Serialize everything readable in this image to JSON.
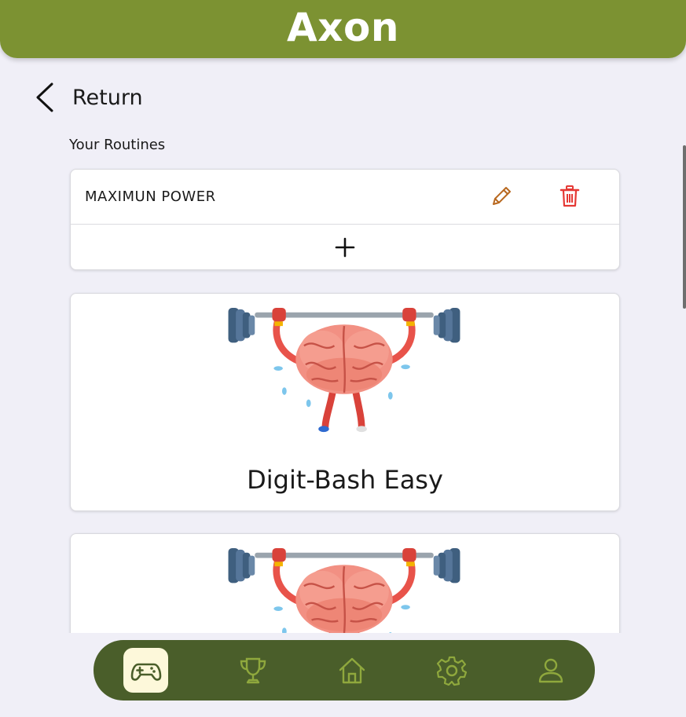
{
  "app": {
    "title": "Axon"
  },
  "nav_back": {
    "label": "Return"
  },
  "routines": {
    "heading": "Your Routines",
    "items": [
      {
        "name": "MAXIMUN POWER"
      }
    ],
    "add_icon": "plus-icon",
    "edit_icon": "pencil-icon",
    "delete_icon": "trash-icon"
  },
  "games": [
    {
      "title": "Digit-Bash Easy",
      "image": "brain-lifting-barbell"
    },
    {
      "title": "",
      "image": "brain-lifting-barbell"
    }
  ],
  "bottom_nav": {
    "items": [
      {
        "icon": "gamepad-icon",
        "active": true
      },
      {
        "icon": "trophy-icon",
        "active": false
      },
      {
        "icon": "home-icon",
        "active": false
      },
      {
        "icon": "gear-icon",
        "active": false
      },
      {
        "icon": "user-icon",
        "active": false
      }
    ]
  },
  "colors": {
    "header": "#7c9232",
    "nav_bar": "#4a5e2a",
    "nav_active_bg": "#fdf8da",
    "nav_icon": "#8fa83d",
    "edit_icon": "#b8681f",
    "delete_icon": "#e53935",
    "background": "#f0eff7"
  }
}
